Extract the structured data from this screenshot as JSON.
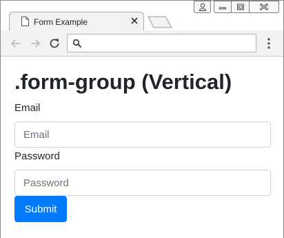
{
  "browser": {
    "tab_title": "Form Example",
    "address_value": "",
    "icons": {
      "tab": "page-icon",
      "close": "close-icon",
      "back": "back-arrow-icon",
      "forward": "forward-arrow-icon",
      "reload": "reload-icon",
      "search": "search-icon",
      "menu": "kebab-menu-icon",
      "user": "user-icon",
      "minimize": "minimize-icon",
      "maximize": "maximize-icon",
      "window_close": "window-close-icon"
    }
  },
  "page": {
    "heading": ".form-group (Vertical)",
    "email_label": "Email",
    "email_placeholder": "Email",
    "email_value": "",
    "password_label": "Password",
    "password_placeholder": "Password",
    "password_value": "",
    "submit_label": "Submit"
  },
  "colors": {
    "primary": "#007bff",
    "text": "#212529",
    "input_border": "#ced4da",
    "placeholder": "#6c757d"
  }
}
